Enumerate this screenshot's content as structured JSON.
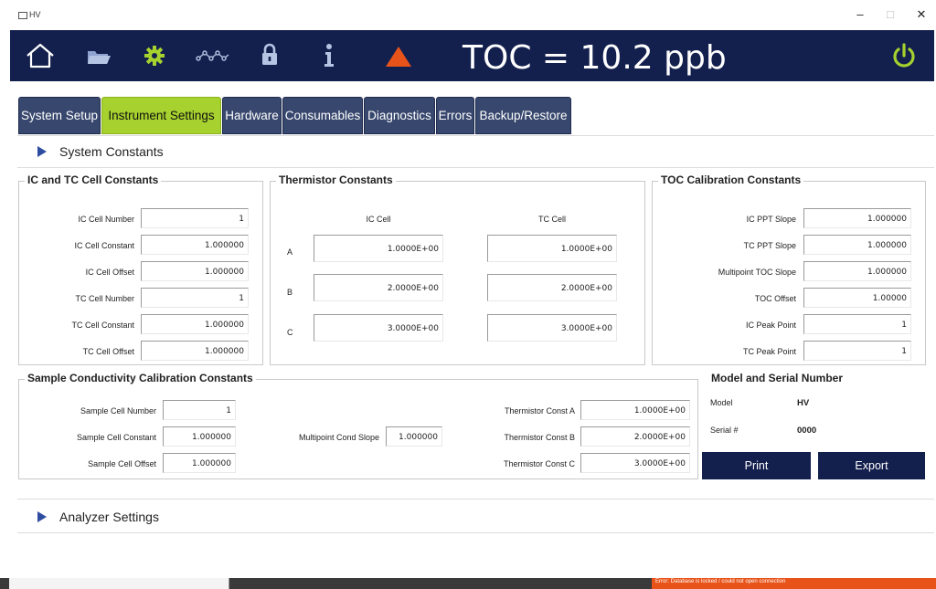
{
  "window": {
    "title": "HV",
    "minimize": "–",
    "maximize": "□",
    "close": "✕"
  },
  "header": {
    "toc_label": "TOC = 10.2 ppb",
    "icons": [
      "home-icon",
      "folder-icon",
      "gear-icon",
      "trend-icon",
      "lock-icon",
      "info-icon",
      "warning-icon",
      "power-icon"
    ],
    "colors": {
      "background": "#13204e",
      "gear": "#a6d12e",
      "warning": "#e8531a",
      "power": "#a6d12e"
    }
  },
  "tabs": [
    {
      "label": "System Setup",
      "active": false
    },
    {
      "label": "Instrument Settings",
      "active": true
    },
    {
      "label": "Hardware",
      "active": false
    },
    {
      "label": "Consumables",
      "active": false
    },
    {
      "label": "Diagnostics",
      "active": false
    },
    {
      "label": "Errors",
      "active": false
    },
    {
      "label": "Backup/Restore",
      "active": false
    }
  ],
  "system_constants": {
    "title": "System Constants",
    "ic_tc": {
      "title": "IC and TC Cell Constants",
      "rows": [
        {
          "label": "IC Cell Number",
          "value": "1"
        },
        {
          "label": "IC Cell Constant",
          "value": "1.000000"
        },
        {
          "label": "IC Cell Offset",
          "value": "1.000000"
        },
        {
          "label": "TC Cell Number",
          "value": "1"
        },
        {
          "label": "TC Cell Constant",
          "value": "1.000000"
        },
        {
          "label": "TC Cell Offset",
          "value": "1.000000"
        }
      ]
    },
    "thermistor": {
      "title": "Thermistor Constants",
      "col_ic": "IC Cell",
      "col_tc": "TC Cell",
      "rows": [
        {
          "label": "A",
          "ic": "1.0000E+00",
          "tc": "1.0000E+00"
        },
        {
          "label": "B",
          "ic": "2.0000E+00",
          "tc": "2.0000E+00"
        },
        {
          "label": "C",
          "ic": "3.0000E+00",
          "tc": "3.0000E+00"
        }
      ]
    },
    "toc_cal": {
      "title": "TOC Calibration Constants",
      "rows": [
        {
          "label": "IC PPT Slope",
          "value": "1.000000"
        },
        {
          "label": "TC PPT Slope",
          "value": "1.000000"
        },
        {
          "label": "Multipoint TOC Slope",
          "value": "1.000000"
        },
        {
          "label": "TOC Offset",
          "value": "1.00000"
        },
        {
          "label": "IC Peak Point",
          "value": "1"
        },
        {
          "label": "TC Peak Point",
          "value": "1"
        }
      ]
    },
    "sample_cond": {
      "title": "Sample Conductivity Calibration Constants",
      "left": [
        {
          "label": "Sample Cell Number",
          "value": "1"
        },
        {
          "label": "Sample Cell Constant",
          "value": "1.000000"
        },
        {
          "label": "Sample Cell Offset",
          "value": "1.000000"
        }
      ],
      "mid": {
        "label": "Multipoint Cond Slope",
        "value": "1.000000"
      },
      "right": [
        {
          "label": "Thermistor Const A",
          "value": "1.0000E+00"
        },
        {
          "label": "Thermistor Const B",
          "value": "2.0000E+00"
        },
        {
          "label": "Thermistor Const C",
          "value": "3.0000E+00"
        }
      ]
    },
    "model_serial": {
      "title": "Model and Serial Number",
      "model_label": "Model",
      "model_value": "HV",
      "serial_label": "Serial #",
      "serial_value": "0000"
    },
    "buttons": {
      "print": "Print",
      "export": "Export"
    }
  },
  "analyzer_settings": {
    "title": "Analyzer Settings"
  },
  "taskbar": {
    "notice": "Error: Database is locked / could not open connection"
  }
}
